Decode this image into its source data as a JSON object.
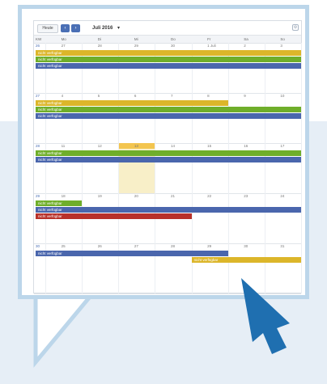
{
  "colors": {
    "yellow": "#dcb62a",
    "green": "#6fae2a",
    "blue": "#4a66ad",
    "red": "#b8312a",
    "highlight": "#f8efc8",
    "highlight_cell": "#f3c54f",
    "cursor": "#1f6fb0"
  },
  "toolbar": {
    "today_label": "Heute",
    "prev_icon": "chevron-left-icon",
    "next_icon": "chevron-right-icon",
    "month": "Juli 2016",
    "month_dropdown_icon": "caret-down-icon",
    "settings_icon": "gear-icon"
  },
  "weekdays": [
    "KW",
    "Mo",
    "Di",
    "Mi",
    "Do",
    "Fr",
    "Sa",
    "So"
  ],
  "weeks": [
    {
      "kw": "26",
      "days": [
        "27",
        "28",
        "29",
        "30",
        "1 Juli",
        "2",
        "3"
      ]
    },
    {
      "kw": "27",
      "days": [
        "4",
        "5",
        "6",
        "7",
        "8",
        "9",
        "10"
      ]
    },
    {
      "kw": "28",
      "days": [
        "11",
        "12",
        "13",
        "14",
        "15",
        "16",
        "17"
      ]
    },
    {
      "kw": "29",
      "days": [
        "18",
        "19",
        "20",
        "21",
        "22",
        "23",
        "24"
      ]
    },
    {
      "kw": "30",
      "days": [
        "25",
        "26",
        "27",
        "28",
        "29",
        "30",
        "31"
      ]
    }
  ],
  "events": [
    {
      "week": 0,
      "row": 0,
      "start": 0,
      "span": 7,
      "color": "yellow",
      "label": "nicht verfügbar"
    },
    {
      "week": 0,
      "row": 1,
      "start": 0,
      "span": 7,
      "color": "green",
      "label": "nicht verfügbar"
    },
    {
      "week": 0,
      "row": 2,
      "start": 0,
      "span": 7,
      "color": "blue",
      "label": "nicht verfügbar"
    },
    {
      "week": 1,
      "row": 0,
      "start": 0,
      "span": 5,
      "color": "yellow",
      "label": "nicht verfügbar"
    },
    {
      "week": 1,
      "row": 1,
      "start": 0,
      "span": 7,
      "color": "green",
      "label": "nicht verfügbar"
    },
    {
      "week": 1,
      "row": 2,
      "start": 0,
      "span": 7,
      "color": "blue",
      "label": "nicht verfügbar"
    },
    {
      "week": 2,
      "row": 0,
      "start": 0,
      "span": 7,
      "color": "green",
      "label": "nicht verfügbar"
    },
    {
      "week": 2,
      "row": 1,
      "start": 0,
      "span": 7,
      "color": "blue",
      "label": "nicht verfügbar"
    },
    {
      "week": 3,
      "row": 0,
      "start": 0,
      "span": 1,
      "color": "green",
      "label": "nicht verfügbar"
    },
    {
      "week": 3,
      "row": 1,
      "start": 0,
      "span": 7,
      "color": "blue",
      "label": "nicht verfügbar"
    },
    {
      "week": 3,
      "row": 2,
      "start": 0,
      "span": 4,
      "color": "red",
      "label": "nicht verfügbar"
    },
    {
      "week": 4,
      "row": 0,
      "start": 0,
      "span": 5,
      "color": "blue",
      "label": "nicht verfügbar"
    },
    {
      "week": 4,
      "row": 1,
      "start": 4,
      "span": 3,
      "color": "yellow",
      "label": "nicht verfügbar"
    }
  ],
  "highlighted_day": {
    "week": 2,
    "day": 2
  }
}
